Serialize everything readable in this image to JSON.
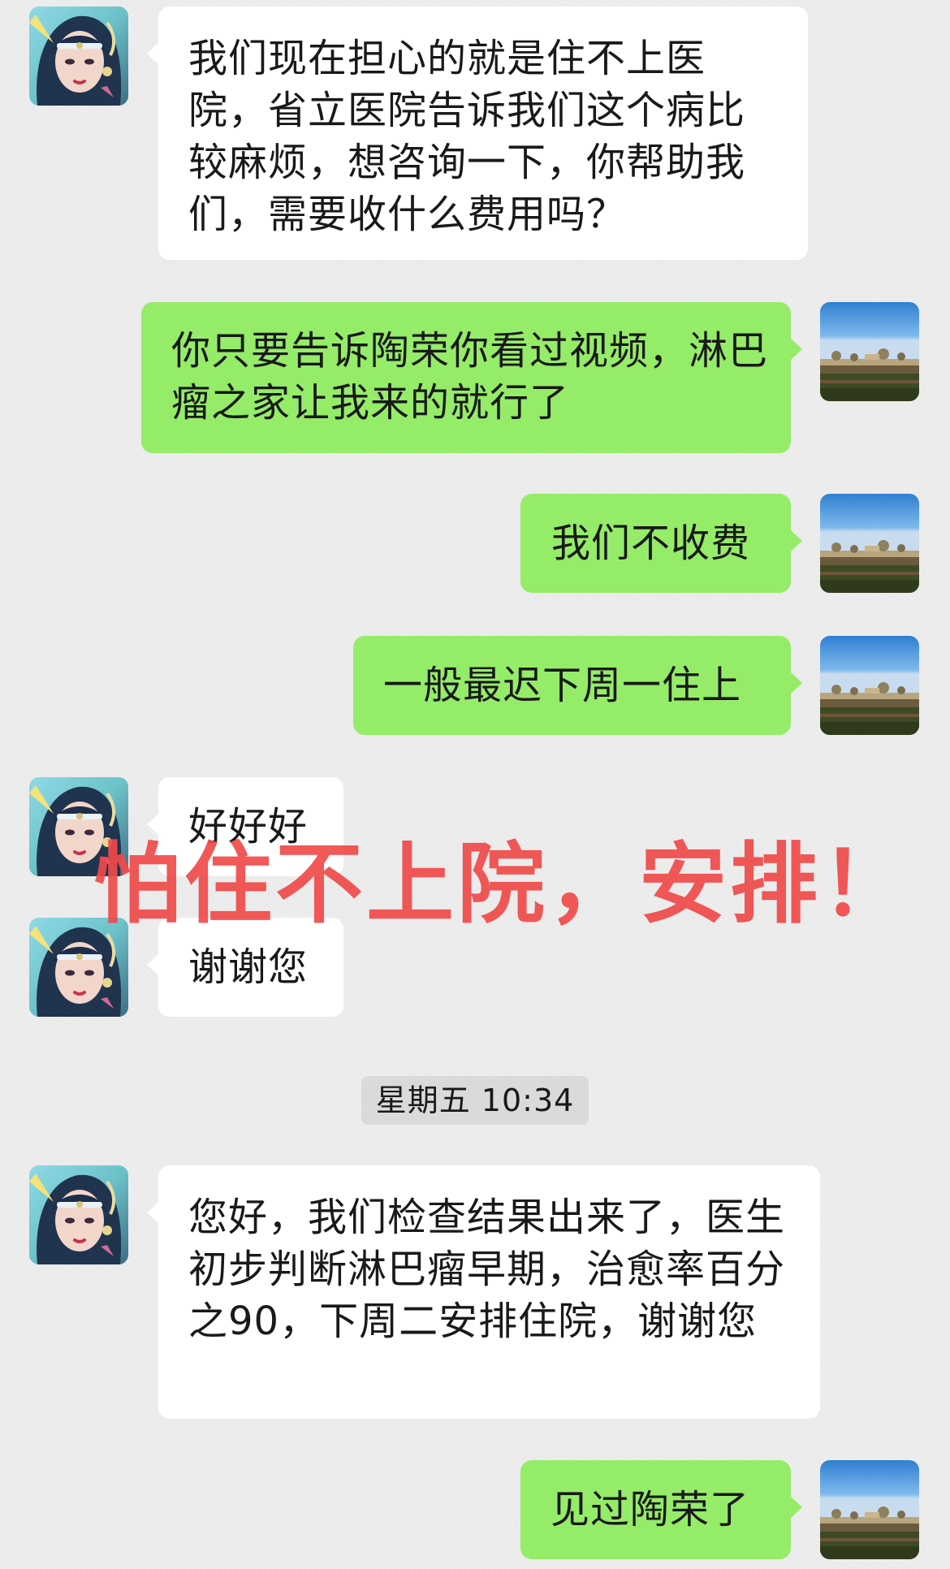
{
  "contact_avatar_icon": "contact-avatar-icon",
  "user_avatar_icon": "landscape-avatar-icon",
  "messages": [
    {
      "side": "in",
      "text": "我们现在担心的就是住不上医院，省立医院告诉我们这个病比较麻烦，想咨询一下，你帮助我们，需要收什么费用吗？"
    },
    {
      "side": "out",
      "text": "你只要告诉陶荣你看过视频，淋巴瘤之家让我来的就行了"
    },
    {
      "side": "out",
      "text": "我们不收费"
    },
    {
      "side": "out",
      "text": "一般最迟下周一住上"
    },
    {
      "side": "in",
      "text": "好好好"
    },
    {
      "side": "in",
      "text": "谢谢您"
    },
    {
      "side": "in",
      "text": "您好，我们检查结果出来了，医生初步判断淋巴瘤早期，治愈率百分之90，下周二安排住院，谢谢您"
    },
    {
      "side": "out",
      "text": "见过陶荣了"
    }
  ],
  "timestamp": "星期五 10:34",
  "overlay_text": "怕住不上院，安排！",
  "colors": {
    "background": "#ededed",
    "incoming_bubble": "#ffffff",
    "outgoing_bubble": "#95ec69",
    "overlay": "#f04a4a"
  }
}
